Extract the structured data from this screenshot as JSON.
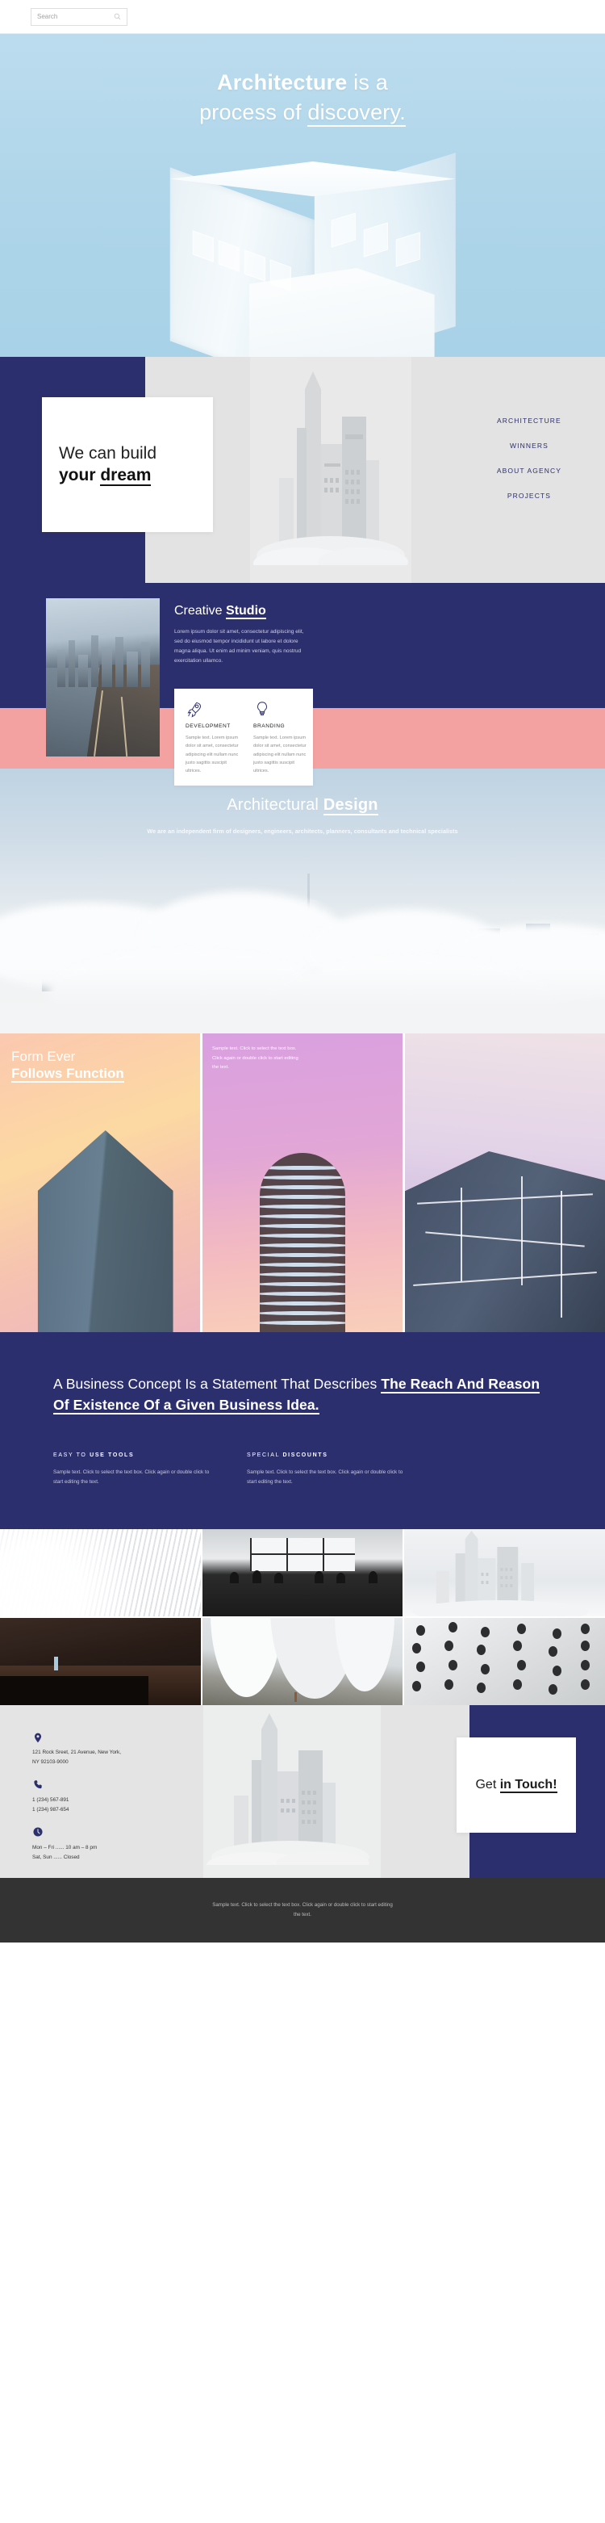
{
  "colors": {
    "navy": "#2c2f6d",
    "pink": "#f3a1a1",
    "sky": "#aed5e9",
    "grey": "#e3e3e3",
    "footer_dark": "#333333"
  },
  "topbar": {
    "search_placeholder": "Search",
    "search_value": "",
    "search_icon": "search-icon"
  },
  "hero": {
    "line1_bold": "Architecture",
    "line1_rest": " is a",
    "line2_pre": "process of ",
    "line2_underlined": "discovery."
  },
  "build_section": {
    "line1": "We can build",
    "line2_pre": "your ",
    "line2_underlined": "dream",
    "nav": [
      {
        "label": "ARCHITECTURE"
      },
      {
        "label": "WINNERS"
      },
      {
        "label": "ABOUT AGENCY"
      },
      {
        "label": "PROJECTS"
      }
    ]
  },
  "studio": {
    "heading_normal": "Creative ",
    "heading_bold": "Studio",
    "paragraph": "Lorem ipsum dolor sit amet, consectetur adipiscing elit, sed do eiusmod tempor incididunt ut labore et dolore magna aliqua. Ut enim ad minim veniam, quis nostrud exercitation ullamco.",
    "cards": [
      {
        "icon": "rocket-icon",
        "title": "DEVELOPMENT",
        "text": "Sample text. Lorem ipsum dolor sit amet, consectetur adipiscing elit nullam nunc justo sagittis suscipit ultrices."
      },
      {
        "icon": "lightbulb-icon",
        "title": "BRANDING",
        "text": "Sample text. Lorem ipsum dolor sit amet, consectetur adipiscing elit nullam nunc justo sagittis suscipit ultrices."
      }
    ]
  },
  "design": {
    "heading_normal": "Architectural ",
    "heading_bold": "Design",
    "subtitle": "We are an independent firm of designers, engineers, architects, planners, consultants and technical specialists"
  },
  "form_section": {
    "line1": "Form Ever",
    "line2": "Follows Function",
    "note": "Sample text. Click to select the text box. Click again or double click to start editing the text."
  },
  "concept": {
    "heading_normal": "A Business Concept Is a Statement That Describes ",
    "heading_bold": "The Reach And Reason Of Existence Of a Given Business Idea.",
    "columns": [
      {
        "title_normal": "EASY TO ",
        "title_bold": "USE TOOLS",
        "text": "Sample text. Click to select the text box. Click again or double click to start editing the text."
      },
      {
        "title_normal": "SPECIAL ",
        "title_bold": "DISCOUNTS",
        "text": "Sample text. Click to select the text box. Click again or double click to start editing the text."
      }
    ]
  },
  "gallery": {
    "items": [
      {
        "name": "white-ribbed-vault"
      },
      {
        "name": "cafe-interior-silhouettes"
      },
      {
        "name": "foggy-skyscrapers"
      },
      {
        "name": "dark-hall-reflecting-pool"
      },
      {
        "name": "curved-white-facade"
      },
      {
        "name": "perforated-circle-facade"
      }
    ]
  },
  "contact": {
    "address_icon": "location-pin-icon",
    "address_line1": "121 Rock Sreet, 21 Avenue, New York,",
    "address_line2": "NY 92103-9000",
    "phone_icon": "phone-icon",
    "phone_line1": "1 (234) 567-891",
    "phone_line2": "1 (234) 987-654",
    "hours_icon": "clock-icon",
    "hours_line1": "Mon – Fri ...... 10 am – 8 pm",
    "hours_line2": "Sat, Sun ...... Closed",
    "touch_normal": "Get ",
    "touch_bold": "in Touch!"
  },
  "footer": {
    "text": "Sample text. Click to select the text box. Click again or double click to start editing the text."
  }
}
